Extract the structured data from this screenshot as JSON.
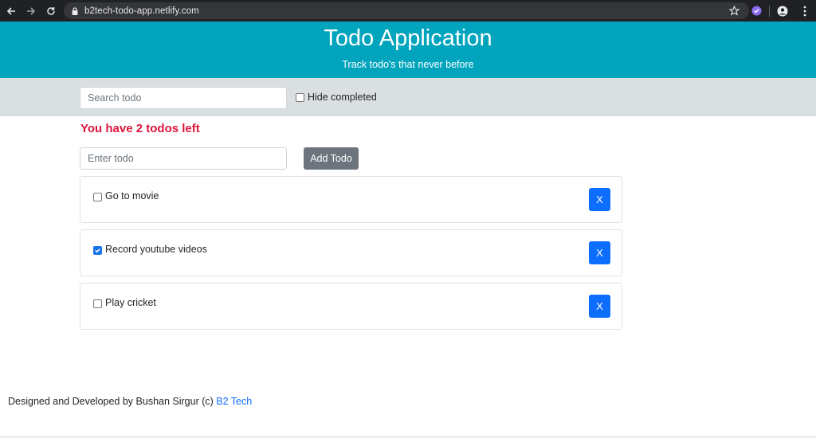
{
  "browser": {
    "url": "b2tech-todo-app.netlify.com",
    "icons": [
      "back-icon",
      "forward-icon",
      "reload-icon",
      "lock-icon",
      "star-icon",
      "extension-icon",
      "account-icon",
      "menu-icon"
    ]
  },
  "header": {
    "title": "Todo Application",
    "subtitle": "Track todo's that never before",
    "bg_color": "#00a4bd"
  },
  "filter": {
    "search_placeholder": "Search todo",
    "search_value": "",
    "hide_completed_label": "Hide completed",
    "hide_completed_checked": false
  },
  "main": {
    "remaining_text": "You have 2 todos left",
    "remaining_color": "#dc143c",
    "todo_placeholder": "Enter todo",
    "todo_value": "",
    "add_label": "Add Todo"
  },
  "todos": [
    {
      "text": "Go to movie",
      "completed": false,
      "delete_label": "X"
    },
    {
      "text": "Record youtube videos",
      "completed": true,
      "delete_label": "X"
    },
    {
      "text": "Play cricket",
      "completed": false,
      "delete_label": "X"
    }
  ],
  "footer": {
    "text": "Designed and Developed by Bushan Sirgur (c) ",
    "link": "B2 Tech"
  }
}
